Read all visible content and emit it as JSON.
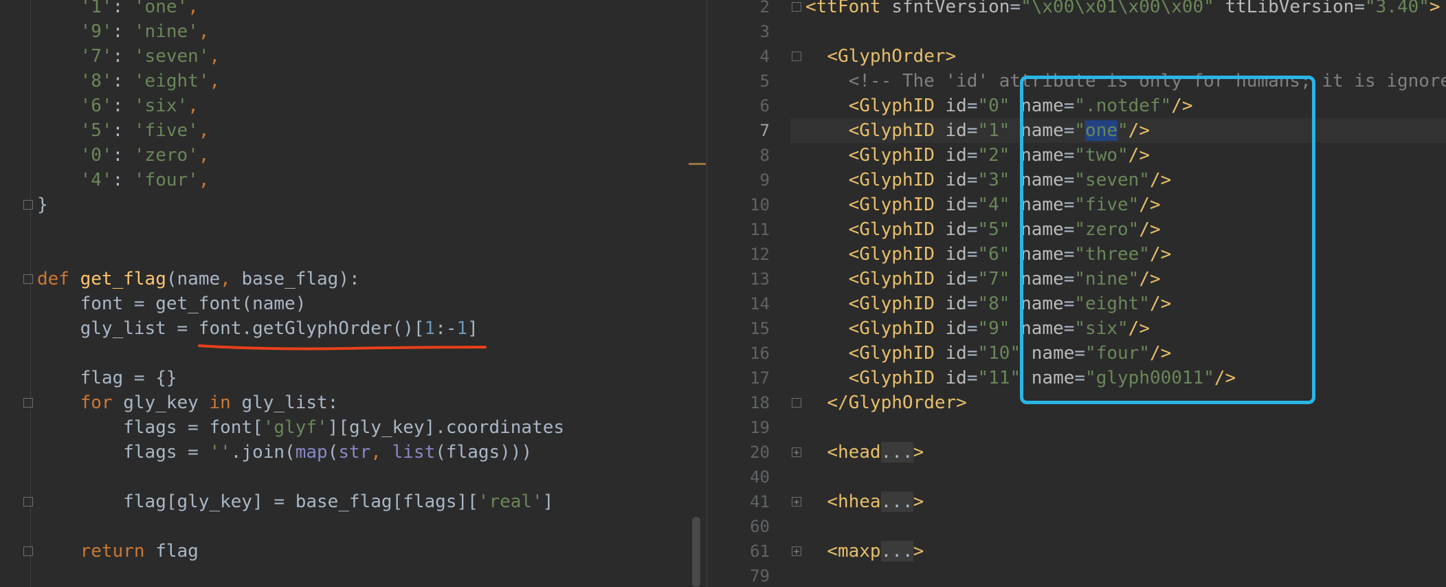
{
  "left_editor": {
    "lines": [
      {
        "indent": "    ",
        "parts": [
          [
            "s",
            "'1'"
          ],
          [
            "p",
            ": "
          ],
          [
            "s",
            "'one'"
          ],
          [
            "k",
            ","
          ]
        ]
      },
      {
        "indent": "    ",
        "parts": [
          [
            "s",
            "'9'"
          ],
          [
            "p",
            ": "
          ],
          [
            "s",
            "'nine'"
          ],
          [
            "k",
            ","
          ]
        ]
      },
      {
        "indent": "    ",
        "parts": [
          [
            "s",
            "'7'"
          ],
          [
            "p",
            ": "
          ],
          [
            "s",
            "'seven'"
          ],
          [
            "k",
            ","
          ]
        ]
      },
      {
        "indent": "    ",
        "parts": [
          [
            "s",
            "'8'"
          ],
          [
            "p",
            ": "
          ],
          [
            "s",
            "'eight'"
          ],
          [
            "k",
            ","
          ]
        ]
      },
      {
        "indent": "    ",
        "parts": [
          [
            "s",
            "'6'"
          ],
          [
            "p",
            ": "
          ],
          [
            "s",
            "'six'"
          ],
          [
            "k",
            ","
          ]
        ]
      },
      {
        "indent": "    ",
        "parts": [
          [
            "s",
            "'5'"
          ],
          [
            "p",
            ": "
          ],
          [
            "s",
            "'five'"
          ],
          [
            "k",
            ","
          ]
        ]
      },
      {
        "indent": "    ",
        "parts": [
          [
            "s",
            "'0'"
          ],
          [
            "p",
            ": "
          ],
          [
            "s",
            "'zero'"
          ],
          [
            "k",
            ","
          ]
        ]
      },
      {
        "indent": "    ",
        "parts": [
          [
            "s",
            "'4'"
          ],
          [
            "p",
            ": "
          ],
          [
            "s",
            "'four'"
          ],
          [
            "k",
            ","
          ]
        ]
      },
      {
        "indent": "",
        "parts": [
          [
            "p",
            "}"
          ]
        ]
      },
      {
        "indent": "",
        "parts": []
      },
      {
        "indent": "",
        "parts": []
      },
      {
        "indent": "",
        "parts": [
          [
            "k",
            "def "
          ],
          [
            "f",
            "get_flag"
          ],
          [
            "p",
            "(name"
          ],
          [
            "k",
            ", "
          ],
          [
            "p",
            "base_flag):"
          ]
        ]
      },
      {
        "indent": "    ",
        "parts": [
          [
            "p",
            "font = get_font(name)"
          ]
        ]
      },
      {
        "indent": "    ",
        "parts": [
          [
            "p",
            "gly_list = font.getGlyphOrder()["
          ],
          [
            "n",
            "1"
          ],
          [
            "p",
            ":-"
          ],
          [
            "n",
            "1"
          ],
          [
            "p",
            "]"
          ]
        ]
      },
      {
        "indent": "",
        "parts": []
      },
      {
        "indent": "    ",
        "parts": [
          [
            "p",
            "flag = {}"
          ]
        ]
      },
      {
        "indent": "    ",
        "parts": [
          [
            "k",
            "for "
          ],
          [
            "p",
            "gly_key "
          ],
          [
            "k",
            "in "
          ],
          [
            "p",
            "gly_list:"
          ]
        ]
      },
      {
        "indent": "        ",
        "parts": [
          [
            "p",
            "flags = font["
          ],
          [
            "s",
            "'glyf'"
          ],
          [
            "p",
            "][gly_key].coordinates"
          ]
        ]
      },
      {
        "indent": "        ",
        "parts": [
          [
            "p",
            "flags = "
          ],
          [
            "s",
            "''"
          ],
          [
            "p",
            ".join("
          ],
          [
            "b",
            "map"
          ],
          [
            "p",
            "("
          ],
          [
            "b",
            "str"
          ],
          [
            "k",
            ", "
          ],
          [
            "b",
            "list"
          ],
          [
            "p",
            "(flags)))"
          ]
        ]
      },
      {
        "indent": "",
        "parts": []
      },
      {
        "indent": "        ",
        "parts": [
          [
            "p",
            "flag[gly_key] = base_flag[flags]["
          ],
          [
            "s",
            "'real'"
          ],
          [
            "p",
            "]"
          ]
        ]
      },
      {
        "indent": "",
        "parts": []
      },
      {
        "indent": "    ",
        "parts": [
          [
            "k",
            "return "
          ],
          [
            "p",
            "flag"
          ]
        ]
      }
    ]
  },
  "right_editor": {
    "current_line": "7",
    "lines": [
      {
        "num": "2",
        "indent": "",
        "parts": [
          [
            "t",
            "<ttFont "
          ],
          [
            "a",
            "sfntVersion"
          ],
          [
            "p",
            "="
          ],
          [
            "s",
            "\"\\x00\\x01\\x00\\x00\" "
          ],
          [
            "a",
            "ttLibVersion"
          ],
          [
            "p",
            "="
          ],
          [
            "s",
            "\"3.40\""
          ],
          [
            "t",
            ">"
          ]
        ]
      },
      {
        "num": "3",
        "indent": "",
        "parts": []
      },
      {
        "num": "4",
        "indent": "  ",
        "parts": [
          [
            "t",
            "<GlyphOrder>"
          ]
        ]
      },
      {
        "num": "5",
        "indent": "    ",
        "parts": [
          [
            "c",
            "<!-- The 'id' attribute is only for humans; it is ignored when parsed. -->"
          ]
        ]
      },
      {
        "num": "6",
        "indent": "    ",
        "parts": [
          [
            "t",
            "<GlyphID "
          ],
          [
            "a",
            "id"
          ],
          [
            "p",
            "="
          ],
          [
            "s",
            "\"0\" "
          ],
          [
            "a",
            "name"
          ],
          [
            "p",
            "="
          ],
          [
            "s",
            "\".notdef\""
          ],
          [
            "t",
            "/>"
          ]
        ]
      },
      {
        "num": "7",
        "indent": "    ",
        "parts": [
          [
            "t",
            "<GlyphID "
          ],
          [
            "a",
            "id"
          ],
          [
            "p",
            "="
          ],
          [
            "s",
            "\"1\" "
          ],
          [
            "a",
            "name"
          ],
          [
            "p",
            "="
          ],
          [
            "s",
            "\""
          ],
          [
            "sel",
            "one"
          ],
          [
            "s",
            "\""
          ],
          [
            "t",
            "/>"
          ]
        ]
      },
      {
        "num": "8",
        "indent": "    ",
        "parts": [
          [
            "t",
            "<GlyphID "
          ],
          [
            "a",
            "id"
          ],
          [
            "p",
            "="
          ],
          [
            "s",
            "\"2\" "
          ],
          [
            "a",
            "name"
          ],
          [
            "p",
            "="
          ],
          [
            "s",
            "\"two\""
          ],
          [
            "t",
            "/>"
          ]
        ]
      },
      {
        "num": "9",
        "indent": "    ",
        "parts": [
          [
            "t",
            "<GlyphID "
          ],
          [
            "a",
            "id"
          ],
          [
            "p",
            "="
          ],
          [
            "s",
            "\"3\" "
          ],
          [
            "a",
            "name"
          ],
          [
            "p",
            "="
          ],
          [
            "s",
            "\"seven\""
          ],
          [
            "t",
            "/>"
          ]
        ]
      },
      {
        "num": "10",
        "indent": "    ",
        "parts": [
          [
            "t",
            "<GlyphID "
          ],
          [
            "a",
            "id"
          ],
          [
            "p",
            "="
          ],
          [
            "s",
            "\"4\" "
          ],
          [
            "a",
            "name"
          ],
          [
            "p",
            "="
          ],
          [
            "s",
            "\"five\""
          ],
          [
            "t",
            "/>"
          ]
        ]
      },
      {
        "num": "11",
        "indent": "    ",
        "parts": [
          [
            "t",
            "<GlyphID "
          ],
          [
            "a",
            "id"
          ],
          [
            "p",
            "="
          ],
          [
            "s",
            "\"5\" "
          ],
          [
            "a",
            "name"
          ],
          [
            "p",
            "="
          ],
          [
            "s",
            "\"zero\""
          ],
          [
            "t",
            "/>"
          ]
        ]
      },
      {
        "num": "12",
        "indent": "    ",
        "parts": [
          [
            "t",
            "<GlyphID "
          ],
          [
            "a",
            "id"
          ],
          [
            "p",
            "="
          ],
          [
            "s",
            "\"6\" "
          ],
          [
            "a",
            "name"
          ],
          [
            "p",
            "="
          ],
          [
            "s",
            "\"three\""
          ],
          [
            "t",
            "/>"
          ]
        ]
      },
      {
        "num": "13",
        "indent": "    ",
        "parts": [
          [
            "t",
            "<GlyphID "
          ],
          [
            "a",
            "id"
          ],
          [
            "p",
            "="
          ],
          [
            "s",
            "\"7\" "
          ],
          [
            "a",
            "name"
          ],
          [
            "p",
            "="
          ],
          [
            "s",
            "\"nine\""
          ],
          [
            "t",
            "/>"
          ]
        ]
      },
      {
        "num": "14",
        "indent": "    ",
        "parts": [
          [
            "t",
            "<GlyphID "
          ],
          [
            "a",
            "id"
          ],
          [
            "p",
            "="
          ],
          [
            "s",
            "\"8\" "
          ],
          [
            "a",
            "name"
          ],
          [
            "p",
            "="
          ],
          [
            "s",
            "\"eight\""
          ],
          [
            "t",
            "/>"
          ]
        ]
      },
      {
        "num": "15",
        "indent": "    ",
        "parts": [
          [
            "t",
            "<GlyphID "
          ],
          [
            "a",
            "id"
          ],
          [
            "p",
            "="
          ],
          [
            "s",
            "\"9\" "
          ],
          [
            "a",
            "name"
          ],
          [
            "p",
            "="
          ],
          [
            "s",
            "\"six\""
          ],
          [
            "t",
            "/>"
          ]
        ]
      },
      {
        "num": "16",
        "indent": "    ",
        "parts": [
          [
            "t",
            "<GlyphID "
          ],
          [
            "a",
            "id"
          ],
          [
            "p",
            "="
          ],
          [
            "s",
            "\"10\" "
          ],
          [
            "a",
            "name"
          ],
          [
            "p",
            "="
          ],
          [
            "s",
            "\"four\""
          ],
          [
            "t",
            "/>"
          ]
        ]
      },
      {
        "num": "17",
        "indent": "    ",
        "parts": [
          [
            "t",
            "<GlyphID "
          ],
          [
            "a",
            "id"
          ],
          [
            "p",
            "="
          ],
          [
            "s",
            "\"11\" "
          ],
          [
            "a",
            "name"
          ],
          [
            "p",
            "="
          ],
          [
            "s",
            "\"glyph00011\""
          ],
          [
            "t",
            "/>"
          ]
        ]
      },
      {
        "num": "18",
        "indent": "  ",
        "parts": [
          [
            "t",
            "</GlyphOrder>"
          ]
        ]
      },
      {
        "num": "19",
        "indent": "",
        "parts": []
      },
      {
        "num": "20",
        "indent": "  ",
        "parts": [
          [
            "t",
            "<head"
          ],
          [
            "pill",
            "..."
          ],
          [
            "t",
            ">"
          ]
        ]
      },
      {
        "num": "40",
        "indent": "",
        "parts": []
      },
      {
        "num": "41",
        "indent": "  ",
        "parts": [
          [
            "t",
            "<hhea"
          ],
          [
            "pill",
            "..."
          ],
          [
            "t",
            ">"
          ]
        ]
      },
      {
        "num": "60",
        "indent": "",
        "parts": []
      },
      {
        "num": "61",
        "indent": "  ",
        "parts": [
          [
            "t",
            "<maxp"
          ],
          [
            "pill",
            "..."
          ],
          [
            "t",
            ">"
          ]
        ]
      },
      {
        "num": "79",
        "indent": "",
        "parts": []
      }
    ]
  }
}
